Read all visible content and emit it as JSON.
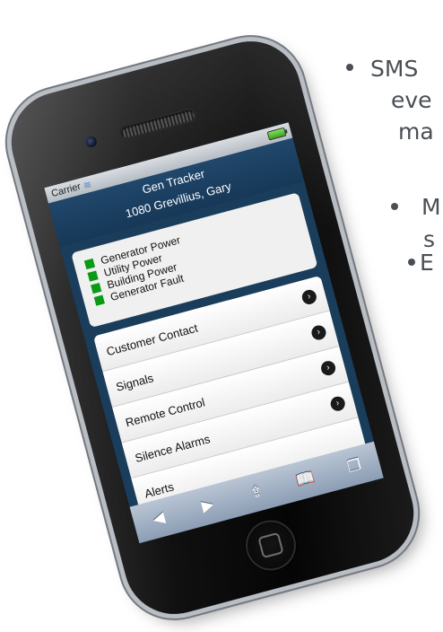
{
  "slide": {
    "bullets": [
      {
        "lines": [
          "SMS",
          "eve",
          "ma"
        ]
      },
      {
        "lines": [
          "M",
          "s"
        ]
      },
      {
        "lines": [
          "E"
        ]
      }
    ]
  },
  "status_bar": {
    "carrier": "Carrier",
    "wifi_icon": "wifi-icon",
    "battery_icon": "battery-icon"
  },
  "app": {
    "title": "Gen Tracker",
    "subtitle": "1080 Grevillius, Gary",
    "signals": [
      {
        "label": "Generator Power",
        "color": "#0a9a16"
      },
      {
        "label": "Utility Power",
        "color": "#0a9a16"
      },
      {
        "label": "Building Power",
        "color": "#0a9a16"
      },
      {
        "label": "Generator Fault",
        "color": "#0a9a16"
      }
    ],
    "menu": [
      {
        "label": "Customer Contact"
      },
      {
        "label": "Signals"
      },
      {
        "label": "Remote Control"
      },
      {
        "label": "Silence Alarms"
      },
      {
        "label": "Alerts"
      }
    ]
  },
  "toolbar": {
    "back": "◀",
    "forward": "▶",
    "share": "⇪",
    "bookmarks": "📖",
    "tabs": "❐"
  },
  "colors": {
    "header": "#173858",
    "screen_bg": "#1a3d5c",
    "led": "#0a9a16"
  }
}
